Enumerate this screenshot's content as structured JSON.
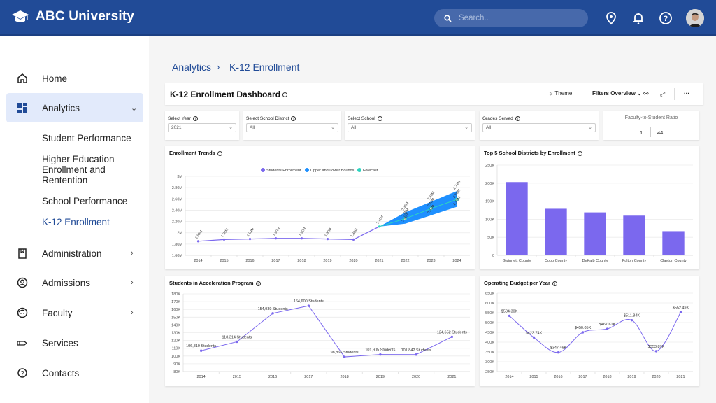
{
  "app": {
    "title": "ABC University",
    "logo_icon": "graduation-cap-icon"
  },
  "topbar": {
    "search_placeholder": "Search..",
    "icons": [
      "location-icon",
      "bell-icon",
      "help-icon"
    ],
    "avatar": "user-avatar"
  },
  "sidebar": {
    "items": [
      {
        "label": "Home",
        "icon": "home-icon"
      },
      {
        "label": "Analytics",
        "icon": "dashboard-icon",
        "expanded": true
      },
      {
        "label": "Administration",
        "icon": "book-icon"
      },
      {
        "label": "Admissions",
        "icon": "user-circle-icon"
      },
      {
        "label": "Faculty",
        "icon": "face-icon"
      },
      {
        "label": "Services",
        "icon": "hand-icon"
      },
      {
        "label": "Contacts",
        "icon": "help-icon"
      }
    ],
    "analytics_sub": [
      "Student Performance",
      "Higher Education Enrollment and Rentention",
      "School Performance",
      "K-12 Enrollment"
    ],
    "active_sub": "K-12 Enrollment"
  },
  "breadcrumb": {
    "parent": "Analytics",
    "separator": "›",
    "current": "K-12 Enrollment"
  },
  "dashboard": {
    "title": "K-12 Enrollment Dashboard",
    "toolbar": {
      "theme": "Theme",
      "filters": "Filters Overview",
      "more": "···"
    }
  },
  "filters": [
    {
      "label": "Select Year",
      "value": "2021"
    },
    {
      "label": "Select School District",
      "value": "All"
    },
    {
      "label": "Select School",
      "value": "All"
    },
    {
      "label": "Grades Served",
      "value": "All"
    }
  ],
  "ratio": {
    "title": "Faculty-to-Student Ratio",
    "faculty": "1",
    "students": "44"
  },
  "chart_data": [
    {
      "type": "line",
      "title": "Enrollment Trends",
      "legend": [
        "Students Enrollment",
        "Upper and Lower Bounds",
        "Forecast"
      ],
      "legend_position": "top-center",
      "colors": {
        "enrollment": "#7b68ee",
        "bounds": "#1e90ff",
        "forecast": "#2dd4bf"
      },
      "x": [
        "2014",
        "2015",
        "2016",
        "2017",
        "2018",
        "2019",
        "2020",
        "2021",
        "2022",
        "2023",
        "2024"
      ],
      "yticks": [
        "1.60M",
        "1.80M",
        "2M",
        "2.20M",
        "2.40M",
        "2.60M",
        "2.80M",
        "3M"
      ],
      "ylim": [
        1.6,
        3.0
      ],
      "series": [
        {
          "name": "Students Enrollment",
          "values": [
            1.85,
            1.88,
            1.89,
            1.9,
            1.9,
            1.89,
            1.88,
            2.11
          ],
          "labels": [
            "1.85M",
            "1.88M",
            "1.89M",
            "1.90M",
            "1.90M",
            "1.89M",
            "1.88M",
            "2.11M"
          ]
        },
        {
          "name": "Forecast",
          "x_start": "2021",
          "values": [
            2.11,
            2.25,
            2.43,
            2.59
          ],
          "labels": [
            "",
            "2.25M",
            "2.43M",
            "2.59M"
          ]
        },
        {
          "name": "Upper Bound",
          "values": [
            2.11,
            2.36,
            2.55,
            2.74
          ],
          "labels": [
            "",
            "2.36M",
            "2.55M",
            "2.74M"
          ]
        },
        {
          "name": "Lower Bound",
          "values": [
            2.11,
            2.16,
            2.31,
            2.46
          ],
          "labels": [
            "",
            "2.16M",
            "2.31M",
            "2.46M"
          ]
        }
      ]
    },
    {
      "type": "bar",
      "title": "Top 5 School Districts by Enrollment",
      "categories": [
        "Gwinnett County",
        "Cobb County",
        "DeKalb County",
        "Fulton County",
        "Clayton County"
      ],
      "values": [
        203000,
        129000,
        119000,
        110000,
        67000
      ],
      "yticks": [
        "0",
        "50K",
        "100K",
        "150K",
        "200K",
        "250K"
      ],
      "ylim": [
        0,
        250000
      ],
      "color": "#7b68ee"
    },
    {
      "type": "line",
      "title": "Students in Acceleration Program",
      "x": [
        "2014",
        "2015",
        "2016",
        "2017",
        "2018",
        "2019",
        "2020",
        "2021"
      ],
      "values": [
        106819,
        118314,
        154939,
        164600,
        98866,
        101905,
        101842,
        124652
      ],
      "labels": [
        "106,819 Students",
        "118,314 Students",
        "154,939 Students",
        "164,600 Students",
        "98,866 Students",
        "101,905 Students",
        "101,842 Students",
        "124,652 Students"
      ],
      "yticks": [
        "80K",
        "90K",
        "100K",
        "110K",
        "120K",
        "130K",
        "140K",
        "150K",
        "160K",
        "170K",
        "180K"
      ],
      "ylim": [
        80000,
        180000
      ],
      "color": "#7b68ee"
    },
    {
      "type": "line",
      "title": "Operating Budget per Year",
      "x": [
        "2014",
        "2015",
        "2016",
        "2017",
        "2018",
        "2019",
        "2020",
        "2021"
      ],
      "values": [
        534300,
        423740,
        347460,
        450050,
        467610,
        511840,
        353870,
        552490
      ],
      "labels": [
        "$534.30K",
        "$423.74K",
        "$347.46K",
        "$450.05K",
        "$467.61K",
        "$511.84K",
        "$353.87K",
        "$552.49K"
      ],
      "yticks": [
        "250K",
        "300K",
        "350K",
        "400K",
        "450K",
        "500K",
        "550K",
        "600K",
        "650K"
      ],
      "ylim": [
        250000,
        650000
      ],
      "smooth": true,
      "color": "#7b68ee"
    }
  ]
}
